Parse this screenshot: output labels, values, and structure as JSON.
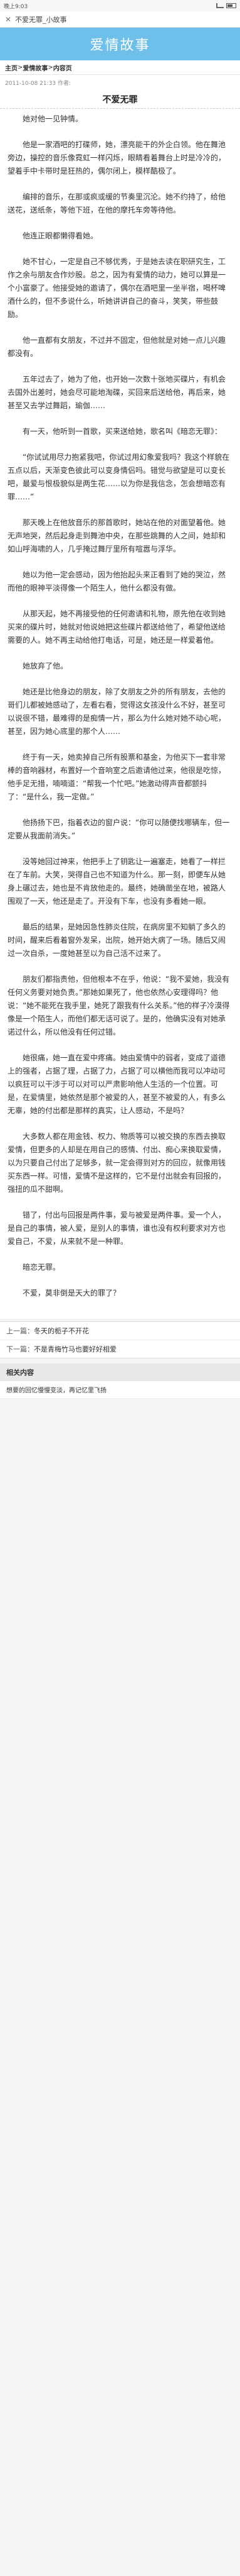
{
  "status": {
    "time": "晚上9:03",
    "network_icon": "signal-icon",
    "battery_icon": "battery-icon"
  },
  "tab": {
    "title": "不爱无罪_小故事"
  },
  "banner": {
    "site_name": "爱情故事"
  },
  "breadcrumb": {
    "items": [
      "主页",
      "爱情故事",
      "内容页"
    ],
    "separator": " > "
  },
  "meta": {
    "published": "2011-10-08 21:33 作者:"
  },
  "article": {
    "title": "不爱无罪",
    "paragraphs": [
      "她对他一见钟情。",
      "他是一家酒吧的打碟师，她，漂亮能干的外企白领。他在舞池旁边，操控的音乐像霓虹一样闪烁，眼睛看着舞台上时是冷冷的，望着手中卡带时是狂热的，偶尔闭上，模样酷极了。",
      "编排的音乐，在那或疯或缓的节奏里沉沦。她不约持了，给他送花，送纸条，等他下班，在他的摩托车旁等待他。",
      "他连正眼都懒得看她。",
      "她不甘心，一定是自己不够优秀，于是她去读在职研究生，工作之余与朋友合作炒股。总之，因为有爱情的动力，她可以算是一个小富豪了。他接受她的邀请了，偶尔在酒吧里一坐半宿，喝杯啤酒什么的，但不多说什么，听她讲讲自己的奋斗，笑笑，带些鼓励。",
      "他一直都有女朋友，不过并不固定，但他就是对她一点儿兴趣都没有。",
      "五年过去了，她为了他，也开始一次数十张地买碟片，有机会去国外出差时，她会尽可能地淘碟，买回来后送给他，再后来，她甚至又去学过舞蹈，瑜伽……",
      "有一天，他听到一首歌，买来送给她，歌名叫《暗恋无罪》：",
      "“你试试用尽力抱紧我吧，你试过用幻象爱我吗？我这个样貌在五点以后，天渐变色彼此可以变身情侣吗。错觉与欲望是可以变长吧，最爱与恨极貌似是两生花……以为你是我信念，怎会想暗恋有罪……”",
      "那天晚上在他放音乐的那首歌时，她站在他的对面望着他。她无声地哭，然后起身走到舞池中央，在那些跳舞的人之间，她却和如山呼海啸的人，几乎掩过舞厅里所有喧嚣与浮华。",
      "她以为他一定会感动，因为他抬起头来正看到了她的哭泣，然而他的眼神平淡得像一个陌生人，他什么都没有做。",
      "从那天起，她不再接受他的任何邀请和礼物，原先他在收到她买来的碟片时，她就对他说她把这些碟片都送给他了，希望他送给需要的人。她不再主动给他打电话，可是，她还是一样爱着他。",
      "她放弃了他。",
      "她还是比他身边的朋友，除了女朋友之外的所有朋友，去他的哥们儿都被她感动了，左看右看，觉得这女孩没什么不好，甚至可以说很不错，最难得的是痴情一片，那么为什么她对她不动心呢，甚至，因为她心底里的那个人……",
      "终于有一天，她卖掉自己所有股票和基金，为他买下一套非常棒的音响器材，布置好一个音响室之后邀请他过来，他很是吃惊，他手足无措，喃喃道：“帮我一个忙吧。”她激动得声音都颤抖了：“是什么，我一定做。”",
      "他扬扬下巴，指着衣边的窗户说：“你可以随便找哪辆车，但一定要从我面前消失。”",
      "没等她回过神来，他把手上了钥匙让一遍塞走，她看了一样拦在了车前。大笑，哭得自己也不知道为什么。那一刻，即便车从她身上碾过去，她也是不肯放他走的。最终，她确凿坐在地，被路人围观了一天，他还是走了。开没有下车，也没有多看她一眼。",
      "最后的结果，是她因急性肺炎住院，在病房里不知躺了多久的时间，醒来后看着窗外发呆，出院，她开始大病了一场。随后又闹过一次自杀，一度她甚至以为自己活不过来了。",
      "朋友们都指责他，但他根本不在乎，他说：“我不爱她，我没有任何义务要对她负责。”那她如果死了，他也依然心安理得吗？他说：“她不能死在我手里，她死了跟我有什么关系。”他的样子冷漠得像是一个陌生人，而他们都无话可说了。是的，他确实没有对她承诺过什么，所以他没有任何过错。",
      "她很痛，她一直在爱中疼痛。她由爱情中的弱者，变成了道德上的强者，占据了理，占据了力，占据了可以横他而我可以冲动可以疯狂可以干涉于可以对可以严肃影响他人生活的一个位置。可是，在爱情里，她依然是那个被爱的人，甚至不被爱的人，有多么无辜，她的付出都是那样的真实，让人感动，不是吗？",
      "大多数人都在用金钱、权力、物质等可以被交换的东西去换取爱情，但更多的人却是在用自己的感情、付出、痴心来换取爱情，以为只要自己付出了足够多，就一定会得到对方的回应，就像用钱买东西一样。可惜，爱情不是这样的，它不是付出就会有回报的，强扭的瓜不甜啊。",
      "错了，付出与回报是两件事，爱与被爱是两件事。爱一个人，是自己的事情，被人爱，是别人的事情，谁也没有权利要求对方也爱自己，不爱，从来就不是一种罪。",
      "暗恋无罪。",
      "不爱，莫非倒是天大的罪了？"
    ]
  },
  "pager": {
    "prev_label": "上一篇：",
    "prev_title": "冬天的栀子不开花",
    "next_label": "下一篇：",
    "next_title": "不是青梅竹马也要好好相爱"
  },
  "related": {
    "heading": "相关内容",
    "items": [
      "想要的回忆慢慢变淡，再记忆里飞扬"
    ]
  }
}
